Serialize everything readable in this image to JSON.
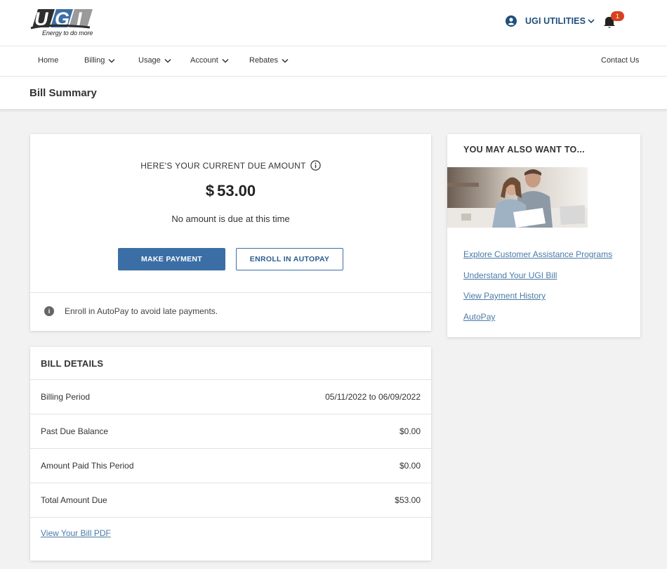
{
  "header": {
    "logo_tagline": "Energy to do more",
    "user_name": "UGI UTILITIES",
    "notification_count": "1"
  },
  "nav": {
    "home": "Home",
    "billing": "Billing",
    "usage": "Usage",
    "account": "Account",
    "rebates": "Rebates",
    "contact": "Contact Us"
  },
  "page": {
    "title": "Bill Summary"
  },
  "due": {
    "heading": "HERE'S YOUR CURRENT DUE AMOUNT",
    "currency": "$",
    "amount": "53.00",
    "subtitle": "No amount is due at this time",
    "make_payment": "MAKE PAYMENT",
    "enroll_autopay": "ENROLL IN AUTOPAY",
    "note": "Enroll in AutoPay to avoid late payments."
  },
  "bill_details": {
    "heading": "BILL DETAILS",
    "rows": [
      {
        "label": "Billing Period",
        "value": "05/11/2022 to 06/09/2022"
      },
      {
        "label": "Past Due Balance",
        "value": "$0.00"
      },
      {
        "label": "Amount Paid This Period",
        "value": "$0.00"
      },
      {
        "label": "Total Amount Due",
        "value": "$53.00"
      }
    ],
    "pdf_link": "View Your Bill PDF"
  },
  "side": {
    "heading": "YOU MAY ALSO WANT TO...",
    "links": [
      "Explore Customer Assistance Programs",
      "Understand Your UGI Bill",
      "View Payment History",
      "AutoPay"
    ]
  },
  "colors": {
    "primary": "#3c6ea6",
    "link": "#4a7aa8",
    "user_name": "#1f4e7c",
    "badge": "#d9411e",
    "page_bg": "#f2f2f2"
  },
  "icons": {
    "user": "account-circle-icon",
    "bell": "bell-icon",
    "info": "info-icon",
    "chevron": "chevron-down-icon"
  }
}
